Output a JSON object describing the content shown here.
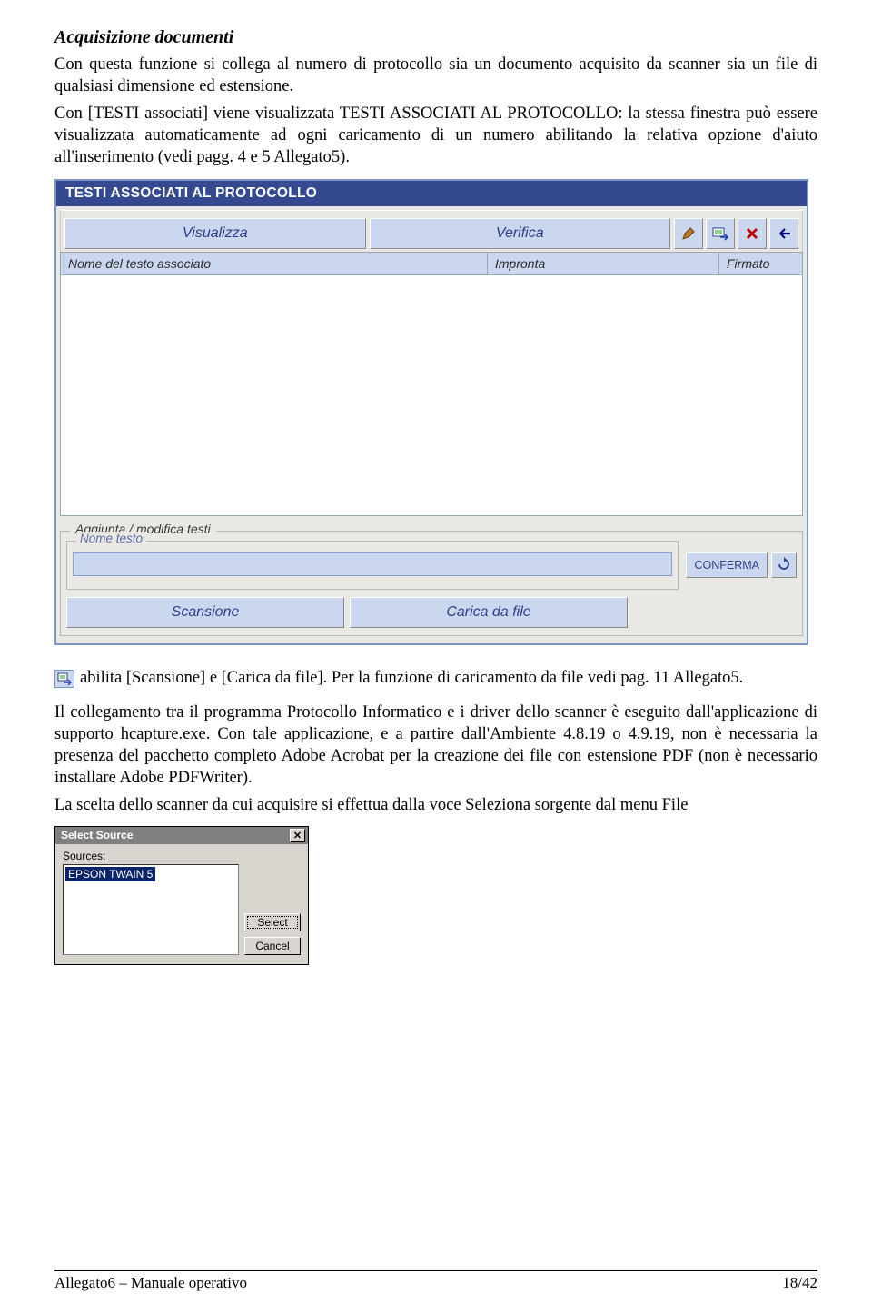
{
  "heading": "Acquisizione documenti",
  "para1": "Con questa funzione si collega al numero di protocollo sia un documento acquisito da scanner sia un file di qualsiasi dimensione ed estensione.",
  "para2": "Con [TESTI associati] viene visualizzata TESTI ASSOCIATI AL PROTOCOLLO: la stessa finestra può essere visualizzata automaticamente ad ogni caricamento di un numero abilitando la relativa opzione d'aiuto all'inserimento (vedi pagg. 4 e 5 Allegato5).",
  "panel": {
    "title": "TESTI ASSOCIATI AL PROTOCOLLO",
    "btn_visualizza": "Visualizza",
    "btn_verifica": "Verifica",
    "cols": {
      "c1": "Nome del testo associato",
      "c2": "Impronta",
      "c3": "Firmato"
    },
    "icons": {
      "edit": "edit-icon",
      "acquire": "acquire-icon",
      "delete": "delete-icon",
      "back": "back-icon"
    },
    "fs2_legend": "Aggiunta / modifica testi",
    "nt_legend": "Nome testo",
    "btn_conferma": "CONFERMA",
    "btn_scansione": "Scansione",
    "btn_carica": "Carica da file"
  },
  "after_icon_line": " abilita [Scansione] e [Carica da file]. Per la funzione di caricamento da file vedi pag. 11 Allegato5.",
  "para3": "Il collegamento tra il programma Protocollo Informatico e i driver dello scanner è eseguito dall'applicazione di supporto hcapture.exe. Con tale applicazione, e a partire dall'Ambiente 4.8.19 o 4.9.19, non è necessaria la presenza del pacchetto completo Adobe Acrobat per la creazione dei file con estensione PDF (non è necessario installare Adobe PDFWriter).",
  "para4": "La scelta dello scanner da cui acquisire si effettua dalla voce Seleziona sorgente dal menu File",
  "dialog": {
    "title": "Select Source",
    "label": "Sources:",
    "item": "EPSON TWAIN 5",
    "btn_select": "Select",
    "btn_cancel": "Cancel"
  },
  "footer": {
    "left": "Allegato6 – Manuale operativo",
    "right": "18/42"
  }
}
